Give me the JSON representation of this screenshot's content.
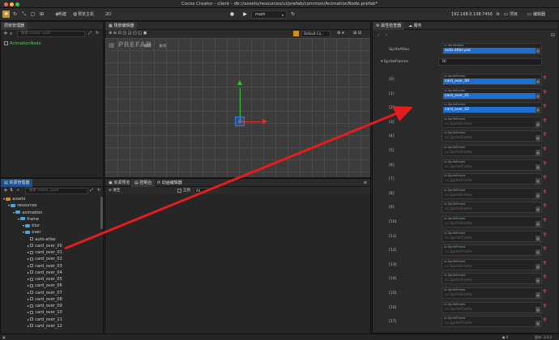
{
  "window": {
    "title": "Cocos Creator - client - db://assets/resources/ui/prefab/common/AnimationNode.prefab*"
  },
  "toolbar": {
    "mode_2d": "2D",
    "project_select": "main",
    "ip_address": "192.168.0.108:7456",
    "btn_project": "项目",
    "btn_editor": "编辑器",
    "btn_build": "构建",
    "btn_preview": "预览主机"
  },
  "hierarchy": {
    "tab": "层级管理器",
    "search_placeholder": "搜索 name, uuid",
    "root_node": "AnimationNode"
  },
  "scene": {
    "tab": "场景编辑器",
    "watermark": "PREFAB",
    "btn_save": "保存",
    "btn_close": "关闭",
    "camera_select": "Default Ca..."
  },
  "assets": {
    "tab": "资源管理器",
    "search_placeholder": "搜索 name, uuid",
    "tree": [
      {
        "label": "assets",
        "depth": 0,
        "kind": "db"
      },
      {
        "label": "resources",
        "depth": 1,
        "kind": "folder"
      },
      {
        "label": "animation",
        "depth": 2,
        "kind": "folder"
      },
      {
        "label": "frame",
        "depth": 3,
        "kind": "folder"
      },
      {
        "label": "blur",
        "depth": 4,
        "kind": "folder"
      },
      {
        "label": "over",
        "depth": 4,
        "kind": "folder"
      },
      {
        "label": "auto-atlas",
        "depth": 5,
        "kind": "file"
      },
      {
        "label": "card_over_00",
        "depth": 5,
        "kind": "image"
      },
      {
        "label": "card_over_01",
        "depth": 5,
        "kind": "image"
      },
      {
        "label": "card_over_02",
        "depth": 5,
        "kind": "image"
      },
      {
        "label": "card_over_03",
        "depth": 5,
        "kind": "image"
      },
      {
        "label": "card_over_04",
        "depth": 5,
        "kind": "image"
      },
      {
        "label": "card_over_05",
        "depth": 5,
        "kind": "image"
      },
      {
        "label": "card_over_06",
        "depth": 5,
        "kind": "image"
      },
      {
        "label": "card_over_07",
        "depth": 5,
        "kind": "image"
      },
      {
        "label": "card_over_08",
        "depth": 5,
        "kind": "image"
      },
      {
        "label": "card_over_09",
        "depth": 5,
        "kind": "image"
      },
      {
        "label": "card_over_10",
        "depth": 5,
        "kind": "image"
      },
      {
        "label": "card_over_11",
        "depth": 5,
        "kind": "image"
      },
      {
        "label": "card_over_12",
        "depth": 5,
        "kind": "image"
      }
    ]
  },
  "bottom_tabs": {
    "preview": "资源预览",
    "console": "控制台",
    "animation": "动画编辑器",
    "clear": "清空",
    "regex": "正则",
    "level": "All"
  },
  "inspector": {
    "tab": "属性检查器",
    "tab_service": "服务",
    "sprite_atlas_label": "SpriteAtlas",
    "sprite_atlas_caption": "cc.SpriteAtlas",
    "sprite_atlas_value": "auto-atlas.pac",
    "sprite_frames_label": "SpriteFrames",
    "sprite_frames_count": "30",
    "frame_caption": "cc.SpriteFrame",
    "frame_placeholder": "cc.SpriteFrame",
    "frames": [
      {
        "index": "[0]",
        "value": "card_over_00",
        "set": true
      },
      {
        "index": "[1]",
        "value": "card_over_01",
        "set": true
      },
      {
        "index": "[2]",
        "value": "card_over_02",
        "set": true
      },
      {
        "index": "[3]",
        "value": "",
        "set": false
      },
      {
        "index": "[4]",
        "value": "",
        "set": false
      },
      {
        "index": "[5]",
        "value": "",
        "set": false
      },
      {
        "index": "[6]",
        "value": "",
        "set": false
      },
      {
        "index": "[7]",
        "value": "",
        "set": false
      },
      {
        "index": "[8]",
        "value": "",
        "set": false
      },
      {
        "index": "[9]",
        "value": "",
        "set": false
      },
      {
        "index": "[10]",
        "value": "",
        "set": false
      },
      {
        "index": "[11]",
        "value": "",
        "set": false
      },
      {
        "index": "[12]",
        "value": "",
        "set": false
      },
      {
        "index": "[13]",
        "value": "",
        "set": false
      },
      {
        "index": "[14]",
        "value": "",
        "set": false
      },
      {
        "index": "[15]",
        "value": "",
        "set": false
      },
      {
        "index": "[16]",
        "value": "",
        "set": false
      },
      {
        "index": "[17]",
        "value": "",
        "set": false
      }
    ]
  },
  "statusbar": {
    "version": "版本: 3.4.0",
    "count": "0"
  },
  "colors": {
    "accent": "#1f6fd0",
    "folder": "#4da3e0",
    "arrow": "#e31d1d"
  }
}
